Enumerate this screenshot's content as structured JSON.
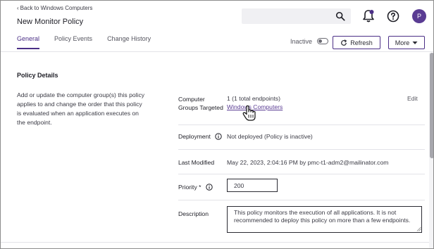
{
  "header": {
    "back_link": "Back to Windows Computers",
    "title": "New Monitor Policy",
    "search": {
      "value": "",
      "placeholder": ""
    },
    "avatar_initial": "P"
  },
  "tabs": [
    {
      "label": "General",
      "active": true
    },
    {
      "label": "Policy Events",
      "active": false
    },
    {
      "label": "Change History",
      "active": false
    }
  ],
  "toolbar": {
    "status_label": "Inactive",
    "toggle_on": false,
    "refresh_label": "Refresh",
    "more_label": "More"
  },
  "policy_details": {
    "section_title": "Policy Details",
    "section_description": "Add or update the computer group(s) this policy applies to and change the order that this policy is evaluated when an application executes on the endpoint.",
    "computer_groups": {
      "label_line1": "Computer",
      "label_line2": "Groups Targeted",
      "count": "1 (1 total endpoints)",
      "group_link": "Windows Computers",
      "edit_label": "Edit"
    },
    "deployment": {
      "label": "Deployment",
      "value": "Not deployed (Policy is inactive)"
    },
    "last_modified": {
      "label": "Last Modified",
      "value": "May 22, 2023, 2:04:16 PM by pmc-t1-adm2@mailinator.com"
    },
    "priority": {
      "label": "Priority *",
      "value": "200"
    },
    "description": {
      "label": "Description",
      "value": "This policy monitors the execution of all applications. It is not recommended to deploy this policy on more than a few endpoints."
    }
  },
  "colors": {
    "accent": "#4b2f86",
    "avatar": "#5a3c93",
    "link": "#5a3c93"
  },
  "icons": {
    "back": "chevron-left-icon",
    "search": "search-icon",
    "notifications": "bell-icon",
    "help": "help-icon",
    "refresh": "refresh-icon",
    "more": "caret-down-icon",
    "info": "info-icon"
  }
}
